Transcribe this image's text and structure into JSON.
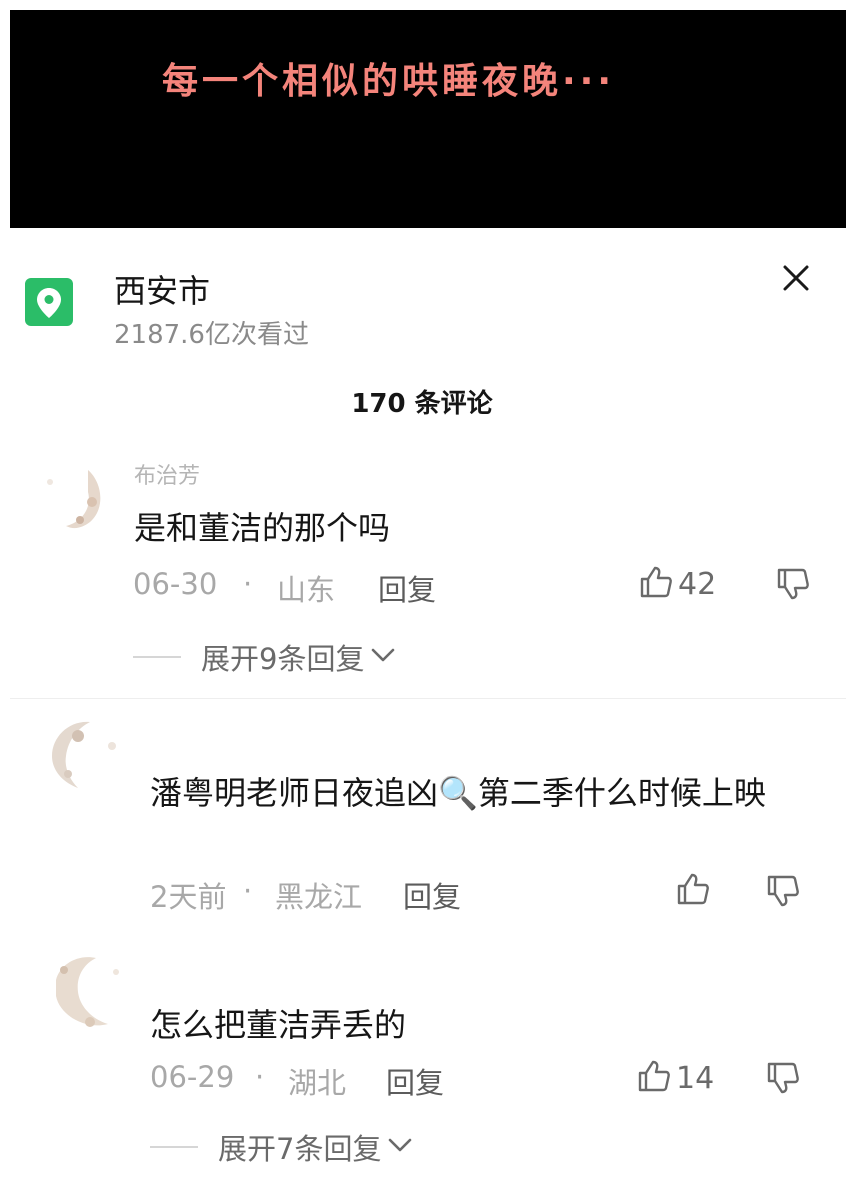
{
  "video": {
    "caption": "每一个相似的哄睡夜晚···"
  },
  "location": {
    "name": "西安市",
    "views": "2187.6亿次看过"
  },
  "comments_header": {
    "count_label": "170 条评论"
  },
  "comments": [
    {
      "username": "布治芳",
      "text": "是和董洁的那个吗",
      "date": "06-30",
      "region": "山东",
      "reply_label": "回复",
      "likes": "42",
      "expand_label": "展开9条回复"
    },
    {
      "username": "",
      "text": "潘粤明老师日夜追凶🔍第二季什么时候上映",
      "date": "2天前",
      "region": "黑龙江",
      "reply_label": "回复",
      "likes": ""
    },
    {
      "username": "",
      "text": "怎么把董洁弄丢的",
      "date": "06-29",
      "region": "湖北",
      "reply_label": "回复",
      "likes": "14",
      "expand_label": "展开7条回复"
    }
  ],
  "separator": "·",
  "colors": {
    "pin_green": "#2bbd68",
    "caption_pink": "#f4847b"
  },
  "icons": [
    "location-pin-icon",
    "close-icon",
    "thumbs-up-icon",
    "thumbs-down-icon",
    "chevron-down-icon"
  ]
}
